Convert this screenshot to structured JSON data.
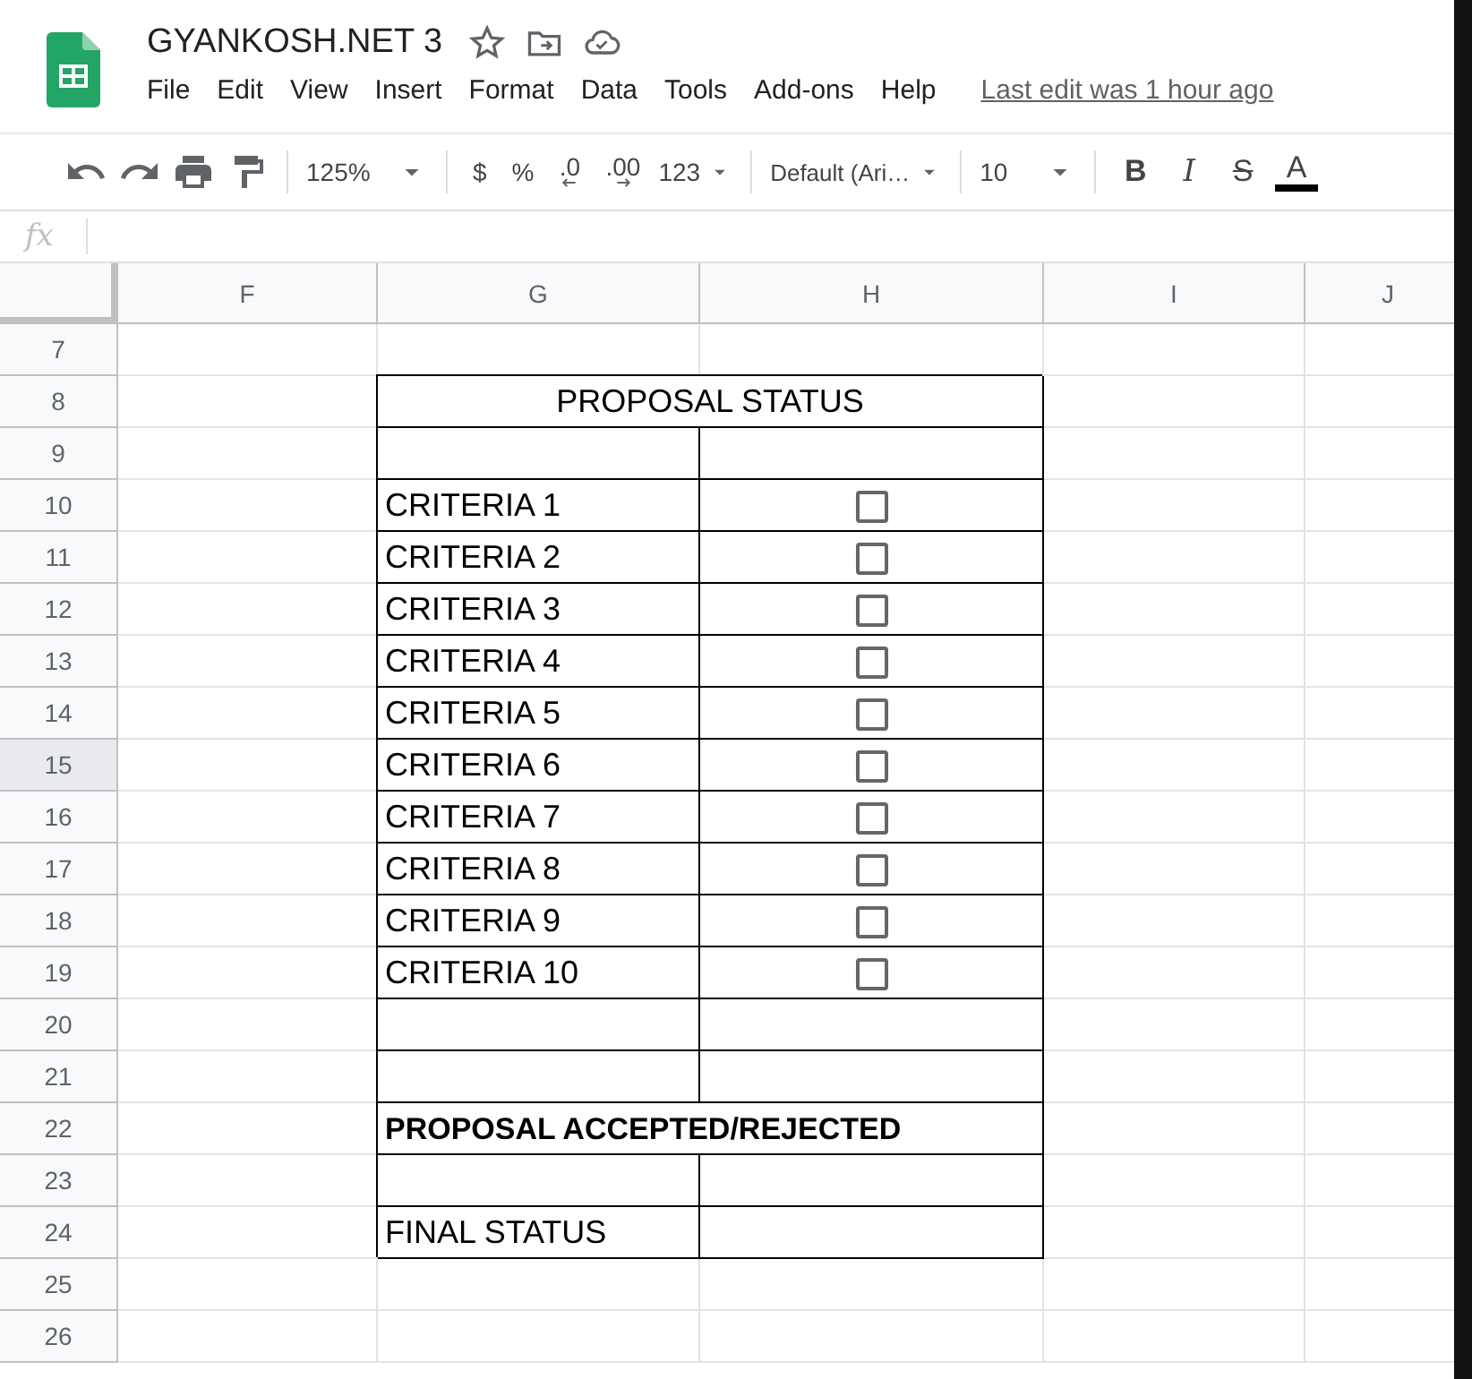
{
  "document": {
    "title": "GYANKOSH.NET 3",
    "last_edit": "Last edit was 1 hour ago"
  },
  "menu": [
    "File",
    "Edit",
    "View",
    "Insert",
    "Format",
    "Data",
    "Tools",
    "Add-ons",
    "Help"
  ],
  "toolbar": {
    "zoom": "125%",
    "currency": "$",
    "percent": "%",
    "decrease_decimals": ".0",
    "increase_decimals": ".00",
    "number_format": "123",
    "font": "Default (Ari…",
    "font_size": "10",
    "bold": "B",
    "italic": "I",
    "strikethrough": "S",
    "text_color": "A"
  },
  "formula_bar": {
    "label": "fx"
  },
  "columns": [
    "F",
    "G",
    "H",
    "I",
    "J"
  ],
  "rows": [
    {
      "number": "7",
      "selected": false,
      "kind": "blank"
    },
    {
      "number": "8",
      "selected": false,
      "kind": "title",
      "text": "PROPOSAL STATUS"
    },
    {
      "number": "9",
      "selected": false,
      "kind": "empty"
    },
    {
      "number": "10",
      "selected": false,
      "kind": "criteria",
      "text": "CRITERIA 1",
      "checked": false
    },
    {
      "number": "11",
      "selected": false,
      "kind": "criteria",
      "text": "CRITERIA 2",
      "checked": false
    },
    {
      "number": "12",
      "selected": false,
      "kind": "criteria",
      "text": "CRITERIA 3",
      "checked": false
    },
    {
      "number": "13",
      "selected": false,
      "kind": "criteria",
      "text": "CRITERIA 4",
      "checked": false
    },
    {
      "number": "14",
      "selected": false,
      "kind": "criteria",
      "text": "CRITERIA 5",
      "checked": false
    },
    {
      "number": "15",
      "selected": true,
      "kind": "criteria",
      "text": "CRITERIA 6",
      "checked": false
    },
    {
      "number": "16",
      "selected": false,
      "kind": "criteria",
      "text": "CRITERIA 7",
      "checked": false
    },
    {
      "number": "17",
      "selected": false,
      "kind": "criteria",
      "text": "CRITERIA 8",
      "checked": false
    },
    {
      "number": "18",
      "selected": false,
      "kind": "criteria",
      "text": "CRITERIA 9",
      "checked": false
    },
    {
      "number": "19",
      "selected": false,
      "kind": "criteria",
      "text": "CRITERIA 10",
      "checked": false
    },
    {
      "number": "20",
      "selected": false,
      "kind": "empty"
    },
    {
      "number": "21",
      "selected": false,
      "kind": "empty"
    },
    {
      "number": "22",
      "selected": false,
      "kind": "heading",
      "text": "PROPOSAL ACCEPTED/REJECTED"
    },
    {
      "number": "23",
      "selected": false,
      "kind": "empty"
    },
    {
      "number": "24",
      "selected": false,
      "kind": "label",
      "text": "FINAL STATUS"
    },
    {
      "number": "25",
      "selected": false,
      "kind": "blank"
    },
    {
      "number": "26",
      "selected": false,
      "kind": "blank"
    }
  ]
}
